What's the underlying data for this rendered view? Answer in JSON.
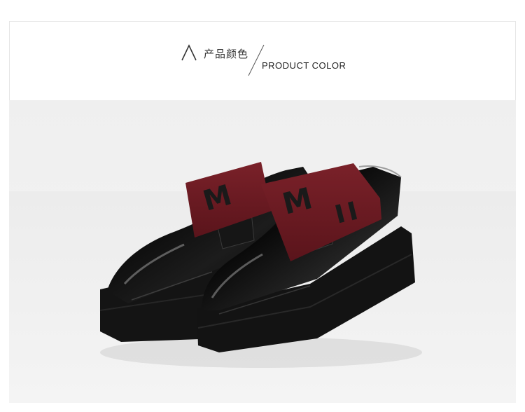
{
  "header": {
    "title_zh": "产品颜色",
    "title_en": "PRODUCT COLOR"
  },
  "photo": {
    "subject": "pair-of-black-patent-platform-loafers-with-burgundy-elastic-strap",
    "colors": {
      "background": "#f0f0f0",
      "shoe": "#111111",
      "strap": "#6e1a22",
      "sole": "#141414"
    }
  }
}
